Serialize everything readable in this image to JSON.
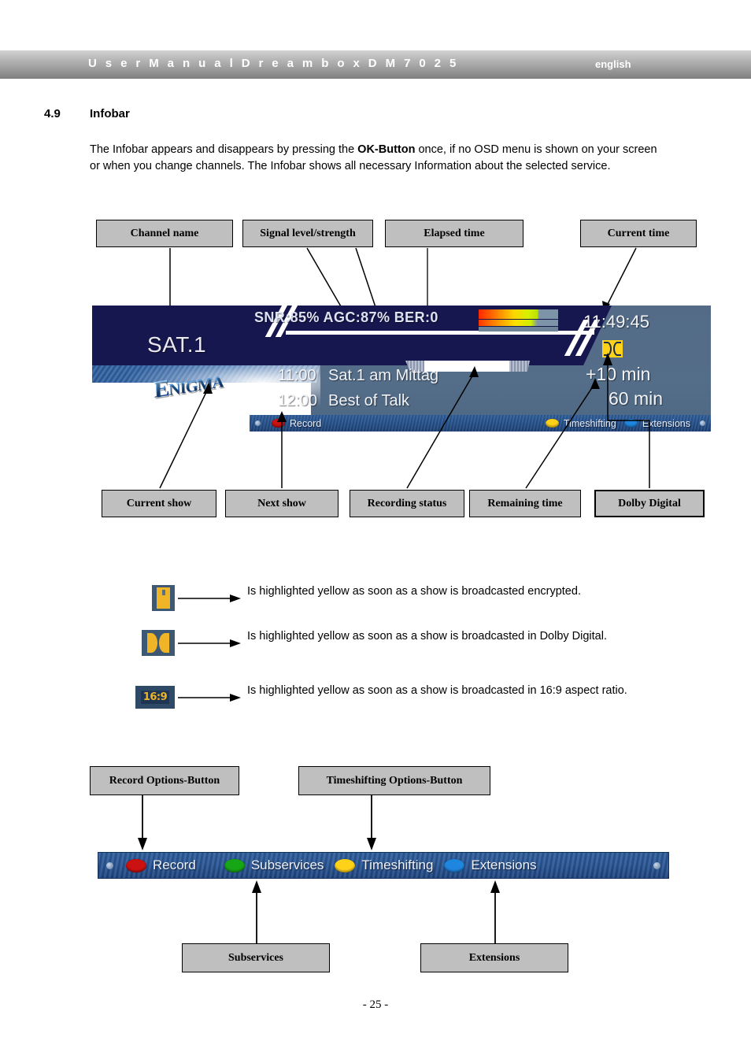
{
  "header": {
    "title": "U s e r   M a n u a l   D r e a m b o x   D M 7 0 2 5",
    "language": "english",
    "bg_gradient_top": "#d2d2d2",
    "bg_gradient_bottom": "#7e7e7e"
  },
  "section": {
    "number": "4.9",
    "title": "Infobar",
    "intro_part1": "The Infobar appears and disappears by pressing the ",
    "intro_bold": "OK-Button",
    "intro_part2": " once, if no OSD menu is shown on your screen or when you change channels. The Infobar shows all necessary Information about the selected service."
  },
  "callouts_top": [
    {
      "label": "Channel name"
    },
    {
      "label": "Signal level/strength"
    },
    {
      "label": "Elapsed time"
    },
    {
      "label": "Current time"
    }
  ],
  "callouts_bottom": [
    {
      "label": "Current show"
    },
    {
      "label": "Next show"
    },
    {
      "label": "Recording status"
    },
    {
      "label": "Remaining time"
    },
    {
      "label": "Dolby Digital"
    }
  ],
  "infobar": {
    "channel_name": "SAT.1",
    "snr_label": "SNR:",
    "snr_value": "85%",
    "agc_label": "AGC:",
    "agc_value": "87%",
    "ber_label": "BER:",
    "ber_value": "0",
    "signal_line": "SNR:85%  AGC:87%  BER:0",
    "current_time": "11:49:45",
    "remaining_time": "+10 min",
    "total_time": "60 min",
    "now_time": "11:00",
    "now_title": "Sat.1 am Mittag",
    "next_time": "12:00",
    "next_title": "Best of Talk",
    "logo_text": "Enigma",
    "navy_color": "#17174f",
    "panel_color": "#546d89",
    "buttons": [
      {
        "color": "#cc1111",
        "label": "Record"
      },
      {
        "color": "#ffd21a",
        "label": "Timeshifting"
      },
      {
        "color": "#1f86e0",
        "label": "Extensions"
      }
    ]
  },
  "legend": [
    {
      "icon": "crypt-icon",
      "text": "Is highlighted yellow as soon as a show is broadcasted encrypted."
    },
    {
      "icon": "dolby-digital-icon",
      "text": "Is highlighted yellow as soon as a show is broadcasted in Dolby Digital."
    },
    {
      "icon": "aspect-16-9-icon",
      "icon_text": "16:9",
      "text": "Is highlighted yellow as soon as a show is broadcasted in 16:9 aspect ratio."
    }
  ],
  "buttonbar_callouts": {
    "record": "Record Options-Button",
    "timeshifting": "Timeshifting Options-Button",
    "subservices": "Subservices",
    "extensions": "Extensions"
  },
  "buttonbar": {
    "buttons": [
      {
        "color": "#cc1111",
        "label": "Record"
      },
      {
        "color": "#16a616",
        "label": "Subservices"
      },
      {
        "color": "#ffd21a",
        "label": "Timeshifting"
      },
      {
        "color": "#1f86e0",
        "label": "Extensions"
      }
    ]
  },
  "footer": {
    "page": "- 25 -"
  }
}
